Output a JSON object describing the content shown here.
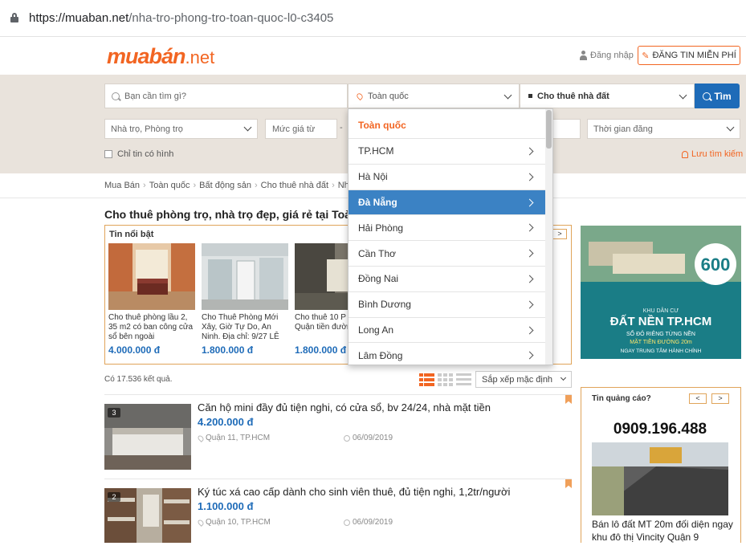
{
  "browser": {
    "url_host": "https://muaban.net",
    "url_path": "/nha-tro-phong-tro-toan-quoc-l0-c3405"
  },
  "header": {
    "logo_main": "muabán",
    "logo_tld": ".net",
    "login_label": "Đăng nhập",
    "post_button": "ĐĂNG TIN MIỄN PHÍ"
  },
  "search": {
    "placeholder": "Bạn cần tìm gì?",
    "location": "Toàn quốc",
    "category": "Cho thuê nhà đất",
    "find_button": "Tìm",
    "filter_type": "Nhà trọ, Phòng trọ",
    "filter_price": "Mức giá từ",
    "filter_dash": "-",
    "filter_time": "Thời gian đăng",
    "only_photos": "Chỉ tin có hình",
    "save_search": "Lưu tìm kiếm"
  },
  "breadcrumb": [
    "Mua Bán",
    "Toàn quốc",
    "Bất động sản",
    "Cho thuê nhà đất",
    "Nhà"
  ],
  "page_title": "Cho thuê phòng trọ, nhà trọ đẹp, giá rẻ tại Toàn quốc",
  "featured": {
    "label": "Tin nổi bật",
    "nav": ">",
    "cards": [
      {
        "title": "Cho thuê phòng lầu 2, 35 m2 có ban công cửa sổ bên ngoài",
        "price": "4.000.000 đ"
      },
      {
        "title": "Cho Thuê Phòng Mới Xây, Giờ Tự Do, An Ninh. Địa chỉ: 9/27 LÊ",
        "price": "1.800.000 đ"
      },
      {
        "title": "Cho thuê 10 P mới xây Quận tiền đường Lạc",
        "price": "1.800.000 đ"
      }
    ]
  },
  "results": {
    "count_text": "Có 17.536 kết quả.",
    "sort_label": "Sắp xếp mặc định",
    "items": [
      {
        "photos": "3",
        "title": "Căn hộ mini đầy đủ tiện nghi, có cửa sổ, bv 24/24, nhà mặt tiền",
        "price": "4.200.000 đ",
        "location": "Quận 11, TP.HCM",
        "date": "06/09/2019"
      },
      {
        "photos": "2",
        "title": "Ký túc xá cao cấp dành cho sinh viên thuê, đủ tiện nghi, 1,2tr/người",
        "price": "1.100.000 đ",
        "location": "Quận 10, TP.HCM",
        "date": "06/09/2019"
      }
    ]
  },
  "ads": {
    "banner": {
      "price_tag": "600",
      "headline": "ĐẤT NỀN TP.HCM",
      "sub1": "KHU DÂN CƯ",
      "sub2": "SỔ ĐỎ RIÊNG TỪNG NỀN",
      "sub3": "MẶT TIỀN ĐƯỜNG 20m",
      "sub4": "NGAY TRUNG TÂM HÀNH CHÍNH"
    },
    "box_label": "Tin quảng cáo?",
    "nav_prev": "<",
    "nav_next": ">",
    "phone": "0909.196.488",
    "caption": "Bán lô đất MT 20m đối diện ngay khu đô thị Vincity Quận 9"
  },
  "location_dropdown": {
    "header": "Toàn quốc",
    "items": [
      "TP.HCM",
      "Hà Nội",
      "Đà Nẵng",
      "Hải Phòng",
      "Cần Thơ",
      "Đồng Nai",
      "Bình Dương",
      "Long An",
      "Lâm Đồng"
    ],
    "active": "Đà Nẵng"
  },
  "colors": {
    "brand_orange": "#f26522",
    "accent_blue": "#1e6bb8",
    "band": "#e9e3dc"
  }
}
